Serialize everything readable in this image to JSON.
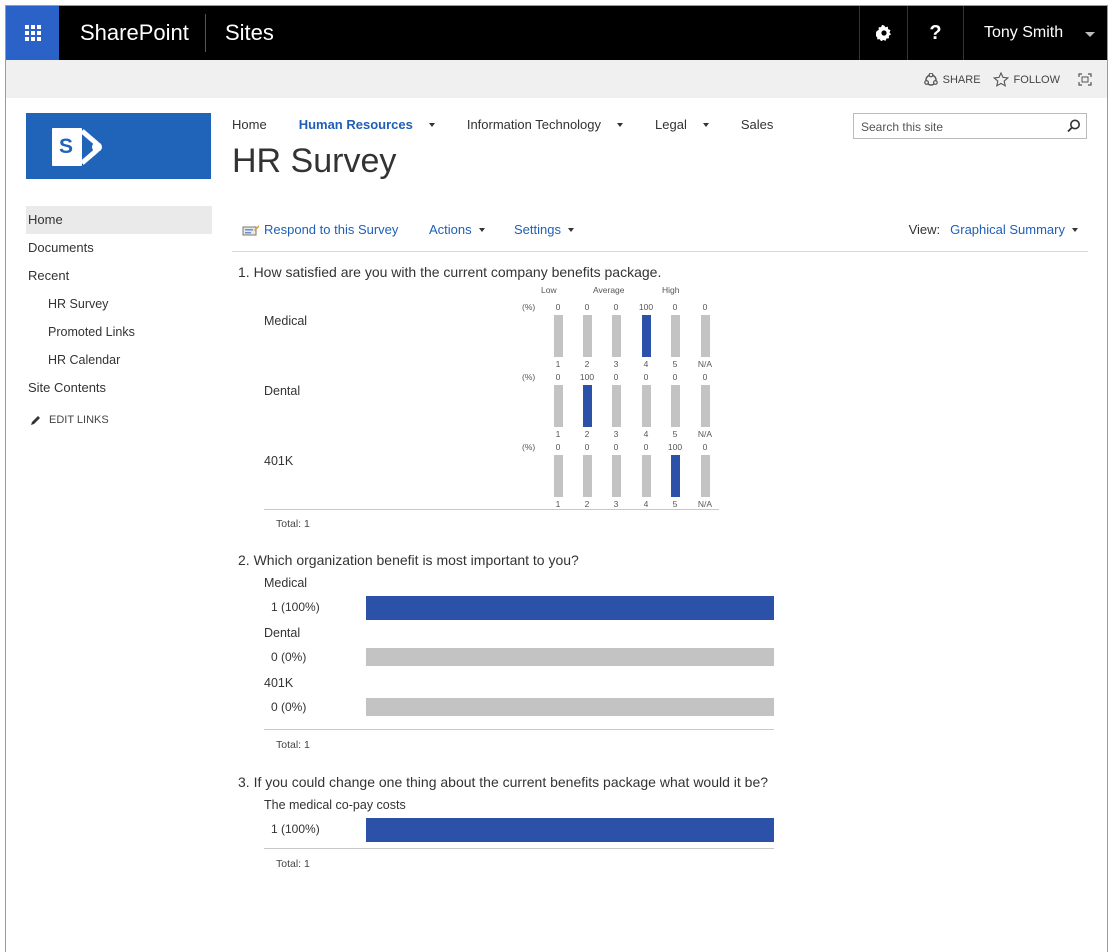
{
  "suite_bar": {
    "brand": "SharePoint",
    "app": "Sites",
    "settings_icon": "gear-icon",
    "help_label": "?",
    "user_name": "Tony Smith",
    "accent": "#2b62c8"
  },
  "share_bar": {
    "share_label": "SHARE",
    "follow_label": "FOLLOW"
  },
  "top_nav": {
    "items": [
      {
        "label": "Home",
        "dropdown": false,
        "selected": false
      },
      {
        "label": "Human Resources",
        "dropdown": true,
        "selected": true
      },
      {
        "label": "Information Technology",
        "dropdown": true,
        "selected": false
      },
      {
        "label": "Legal",
        "dropdown": true,
        "selected": false
      },
      {
        "label": "Sales",
        "dropdown": false,
        "selected": false
      }
    ],
    "search_placeholder": "Search this site"
  },
  "page_title": "HR Survey",
  "left_nav": {
    "items": [
      {
        "label": "Home",
        "active": true,
        "sub": false
      },
      {
        "label": "Documents",
        "active": false,
        "sub": false
      },
      {
        "label": "Recent",
        "active": false,
        "sub": false
      },
      {
        "label": "HR Survey",
        "active": false,
        "sub": true
      },
      {
        "label": "Promoted Links",
        "active": false,
        "sub": true
      },
      {
        "label": "HR Calendar",
        "active": false,
        "sub": true
      },
      {
        "label": "Site Contents",
        "active": false,
        "sub": false
      }
    ],
    "edit_links": "EDIT LINKS"
  },
  "toolbar": {
    "respond": "Respond to this Survey",
    "actions": "Actions",
    "settings": "Settings",
    "view_label": "View:",
    "view_value": "Graphical Summary"
  },
  "questions": {
    "q1": {
      "title": "1. How satisfied are you with the current company benefits package.",
      "scale_low": "Low",
      "scale_avg": "Average",
      "scale_high": "High",
      "pct": "(%)",
      "columns": [
        "1",
        "2",
        "3",
        "4",
        "5",
        "N/A"
      ],
      "rows": [
        {
          "label": "Medical",
          "values": [
            0,
            0,
            0,
            100,
            0,
            0
          ]
        },
        {
          "label": "Dental",
          "values": [
            0,
            100,
            0,
            0,
            0,
            0
          ]
        },
        {
          "label": "401K",
          "values": [
            0,
            0,
            0,
            0,
            100,
            0
          ]
        }
      ],
      "total": "Total: 1"
    },
    "q2": {
      "title": "2. Which organization benefit is most important to you?",
      "options": [
        {
          "label": "Medical",
          "count": "1 (100%)",
          "fraction": 1.0
        },
        {
          "label": "Dental",
          "count": "0 (0%)",
          "fraction": 0.0
        },
        {
          "label": "401K",
          "count": "0 (0%)",
          "fraction": 0.0
        }
      ],
      "total": "Total: 1"
    },
    "q3": {
      "title": "3. If you could change one thing about the current benefits package what would it be?",
      "options": [
        {
          "label": "The medical co-pay costs",
          "count": "1 (100%)",
          "fraction": 1.0
        }
      ],
      "total": "Total: 1"
    }
  },
  "colors": {
    "bar_fill": "#2b52a8",
    "bar_track": "#c3c3c3",
    "link": "#1f5fb8",
    "logo": "#1f64b9"
  }
}
